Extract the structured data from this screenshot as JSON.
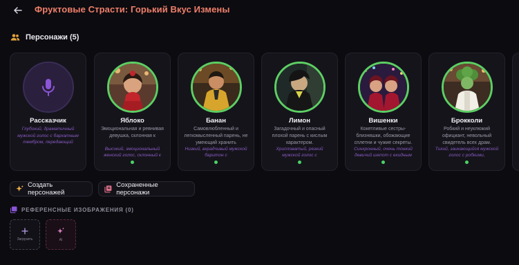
{
  "header": {
    "title": "Фруктовые Страсти: Горький Вкус Измены"
  },
  "characters_section": {
    "title": "Персонажи (5)"
  },
  "characters": [
    {
      "name": "Рассказчик",
      "description": "",
      "voice": "Глубокий, драматичный мужской голос с бархатным тембром, передающий",
      "has_status": false
    },
    {
      "name": "Яблоко",
      "description": "Эмоциональная и ревнивая девушка, склонная к",
      "voice": "Высокий, эмоциональный женский голос, склонный к",
      "has_status": true
    },
    {
      "name": "Банан",
      "description": "Самовлюбленный и легкомысленный парень, не умеющий хранить",
      "voice": "Низкий, вкрадчивый мужской баритон с",
      "has_status": true
    },
    {
      "name": "Лимон",
      "description": "Загадочный и опасный плохой парень с кислым характером.",
      "voice": "Хрипловатый, резкий мужской голос с",
      "has_status": true
    },
    {
      "name": "Вишенки",
      "description": "Кокетливые сестры-близняшки, обожающие сплетни и чужие секреты.",
      "voice": "Синхронный, очень тонкий девичий шепот с ехидным",
      "has_status": true
    },
    {
      "name": "Брокколи",
      "description": "Робкий и неуклюжий официант, невольный свидетель всех драм.",
      "voice": "Тихий, заикающийся мужской голос с робкими,",
      "has_status": true
    }
  ],
  "actions": {
    "create_label": "Создать персонажей",
    "saved_label": "Сохраненные персонажи"
  },
  "references": {
    "title": "РЕФЕРЕНСНЫЕ ИЗОБРАЖЕНИЯ (0)",
    "upload_label": "Загрузить",
    "ai_label": "AI"
  },
  "colors": {
    "accent": "#ef7f6a",
    "status": "#4bd467",
    "ring": "#5dcf63",
    "purple": "#8b5cc4"
  }
}
